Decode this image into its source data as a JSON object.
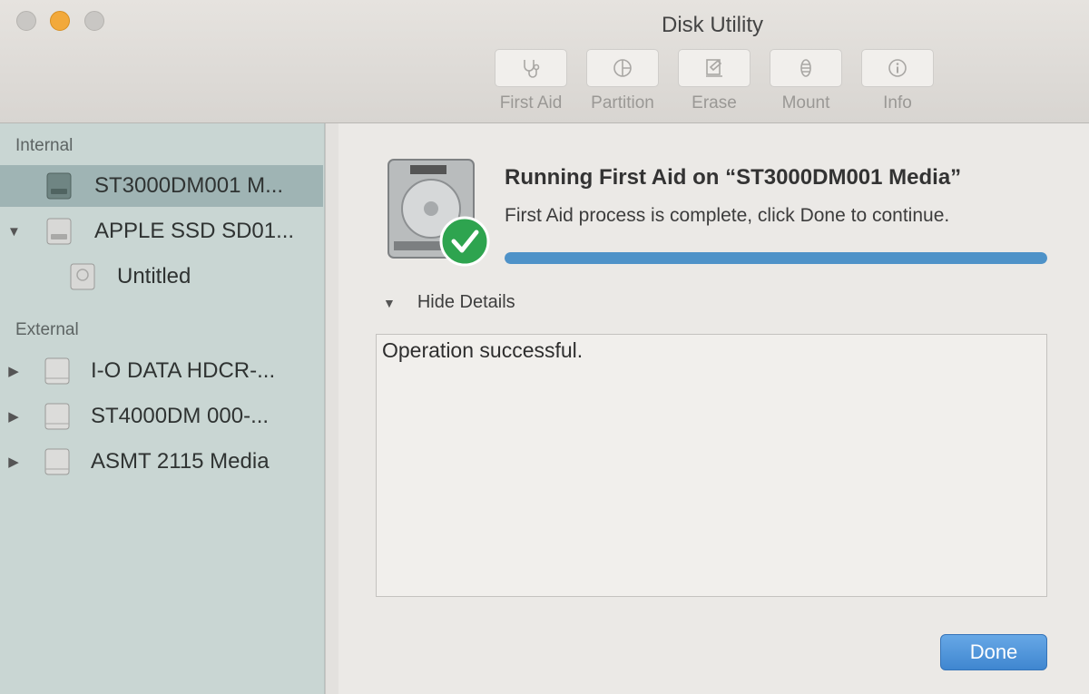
{
  "window": {
    "title": "Disk Utility"
  },
  "toolbar": {
    "items": [
      {
        "label": "First Aid",
        "icon": "stethoscope-icon"
      },
      {
        "label": "Partition",
        "icon": "partition-icon"
      },
      {
        "label": "Erase",
        "icon": "erase-icon"
      },
      {
        "label": "Mount",
        "icon": "mount-icon"
      },
      {
        "label": "Info",
        "icon": "info-icon"
      }
    ]
  },
  "sidebar": {
    "internal_header": "Internal",
    "external_header": "External",
    "internal_items": [
      {
        "label": "ST3000DM001 M...",
        "selected": true
      },
      {
        "label": "APPLE SSD SD01...",
        "expanded": true
      },
      {
        "label": "Untitled"
      }
    ],
    "external_items": [
      {
        "label": "I-O DATA HDCR-..."
      },
      {
        "label": "ST4000DM 000-..."
      },
      {
        "label": "ASMT 2115 Media"
      }
    ]
  },
  "main": {
    "title": "Running First Aid on “ST3000DM001 Media”",
    "subtitle": "First Aid process is complete, click Done to continue.",
    "progress": 1.0,
    "details_toggle": "Hide Details",
    "details_text": "Operation successful.",
    "done_label": "Done"
  },
  "colors": {
    "sidebar_bg": "#c9d6d3",
    "selection": "#9fb4b4",
    "progress_fill": "#4e92c8",
    "done_button": "#4a8fd6",
    "success_green": "#2ea44f"
  }
}
